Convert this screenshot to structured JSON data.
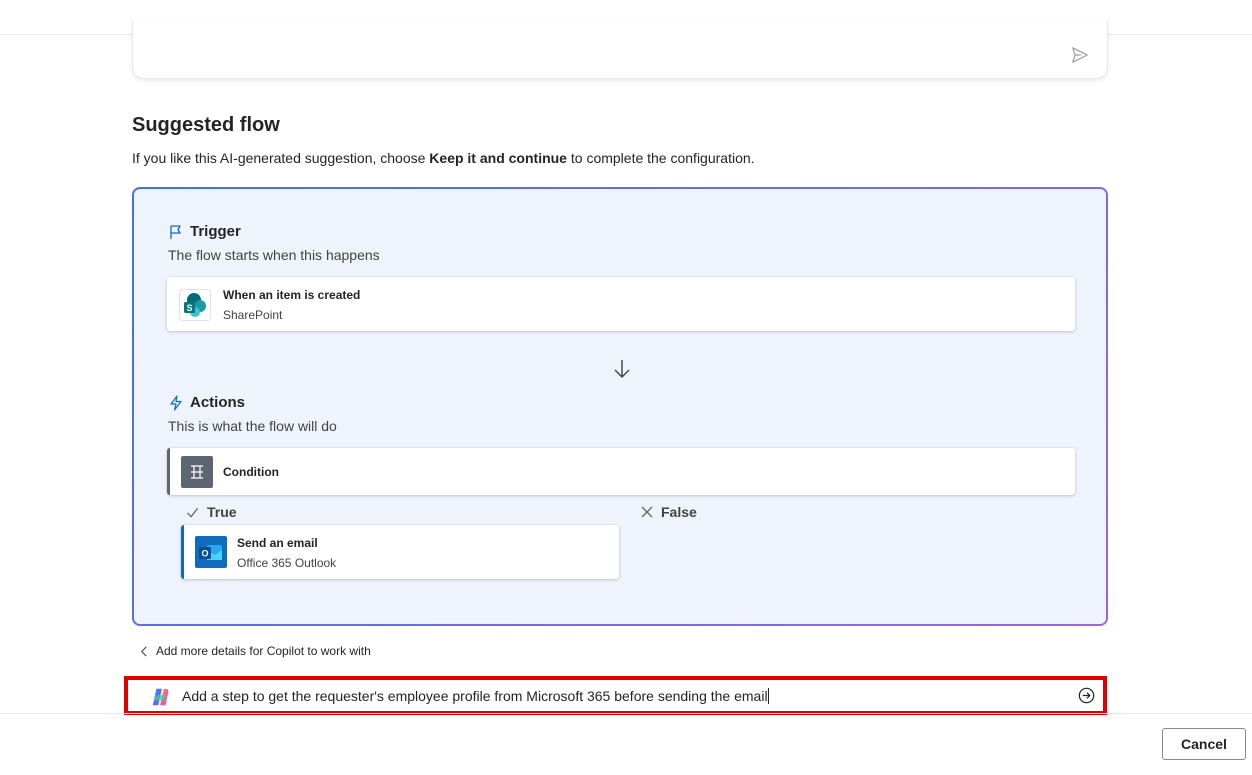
{
  "suggested": {
    "title": "Suggested flow",
    "sub_prefix": "If you like this AI-generated suggestion, choose ",
    "sub_bold": "Keep it and continue",
    "sub_suffix": " to complete the configuration."
  },
  "trigger": {
    "heading": "Trigger",
    "subtitle": "The flow starts when this happens",
    "card": {
      "title": "When an item is created",
      "connector": "SharePoint"
    }
  },
  "actions": {
    "heading": "Actions",
    "subtitle": "This is what the flow will do",
    "condition": {
      "title": "Condition"
    },
    "true_label": "True",
    "false_label": "False",
    "true_step": {
      "title": "Send an email",
      "connector": "Office 365 Outlook"
    }
  },
  "back_link": "Add more details for Copilot to work with",
  "copilot_input": {
    "value": "Add a step to get the requester's employee profile from Microsoft 365 before sending the email"
  },
  "footer": {
    "cancel_label": "Cancel"
  },
  "colors": {
    "panel_bg": "#eff4fc",
    "trigger_icon": "#0f6cbd",
    "condition_accent": "#5c6670",
    "email_accent": "#0f6cbd",
    "highlight": "#e00000"
  },
  "icons": {
    "send": "send-icon",
    "trigger": "flag-icon",
    "actions": "lightning-icon",
    "sharepoint": "sharepoint-icon",
    "condition": "condition-icon",
    "outlook": "outlook-icon",
    "copilot": "copilot-icon",
    "submit": "arrow-circle-icon"
  }
}
